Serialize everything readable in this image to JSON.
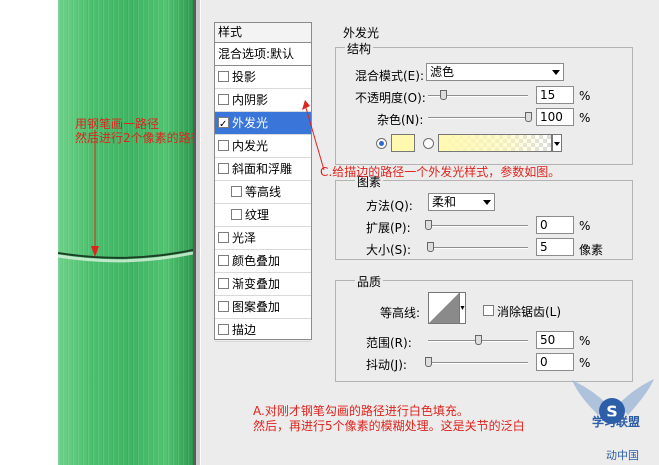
{
  "canvas_annotation_1": [
    "用钢笔画一路径",
    "然后进行2个像素的路径描边。"
  ],
  "annotation_c": "C.给描边的路径一个外发光样式，参数如图。",
  "annotation_a": [
    "A.对刚才钢笔勾画的路径进行白色填充。",
    "然后，再进行5个像素的模糊处理。这是关节的泛白"
  ],
  "watermark": {
    "logo_text": "学习联盟",
    "sub": "动中国"
  },
  "styles_panel": {
    "title": "样式",
    "blend_default": "混合选项:默认",
    "items": [
      {
        "label": "投影",
        "checked": false,
        "selected": false,
        "sub": false
      },
      {
        "label": "内阴影",
        "checked": false,
        "selected": false,
        "sub": false
      },
      {
        "label": "外发光",
        "checked": true,
        "selected": true,
        "sub": false
      },
      {
        "label": "内发光",
        "checked": false,
        "selected": false,
        "sub": false
      },
      {
        "label": "斜面和浮雕",
        "checked": false,
        "selected": false,
        "sub": false
      },
      {
        "label": "等高线",
        "checked": false,
        "selected": false,
        "sub": true
      },
      {
        "label": "纹理",
        "checked": false,
        "selected": false,
        "sub": true
      },
      {
        "label": "光泽",
        "checked": false,
        "selected": false,
        "sub": false
      },
      {
        "label": "颜色叠加",
        "checked": false,
        "selected": false,
        "sub": false
      },
      {
        "label": "渐变叠加",
        "checked": false,
        "selected": false,
        "sub": false
      },
      {
        "label": "图案叠加",
        "checked": false,
        "selected": false,
        "sub": false
      },
      {
        "label": "描边",
        "checked": false,
        "selected": false,
        "sub": false
      }
    ]
  },
  "outer_glow": {
    "title": "外发光",
    "structure": {
      "title": "结构",
      "blend_mode_label": "混合模式(E):",
      "blend_mode": "滤色",
      "opacity_label": "不透明度(O):",
      "opacity": "15",
      "opacity_level": 0.15,
      "noise_label": "杂色(N):",
      "noise": "100",
      "noise_level": 1.0,
      "unit": "%",
      "color_swatch": "#fff9b0"
    },
    "elements": {
      "title": "图素",
      "technique_label": "方法(Q):",
      "technique": "柔和",
      "spread_label": "扩展(P):",
      "spread": "0",
      "spread_level": 0.0,
      "size_label": "大小(S):",
      "size": "5",
      "size_level": 0.02,
      "unit_pct": "%",
      "unit_px": "像素"
    },
    "quality": {
      "title": "品质",
      "contour_label": "等高线:",
      "antialias_label": "消除锯齿(L)",
      "range_label": "范围(R):",
      "range": "50",
      "range_level": 0.5,
      "jitter_label": "抖动(J):",
      "jitter": "0",
      "jitter_level": 0.0,
      "unit": "%"
    }
  }
}
